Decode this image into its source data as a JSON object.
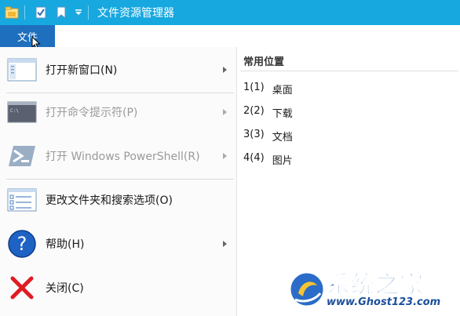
{
  "window": {
    "title": "文件资源管理器"
  },
  "ribbon": {
    "file_tab": "文件"
  },
  "menu": {
    "items": [
      {
        "label": "打开新窗口(N)",
        "enabled": true,
        "submenu": true,
        "icon": "new-window-icon"
      },
      {
        "label": "打开命令提示符(P)",
        "enabled": false,
        "submenu": true,
        "icon": "command-prompt-icon"
      },
      {
        "label": "打开 Windows PowerShell(R)",
        "enabled": false,
        "submenu": true,
        "icon": "powershell-icon"
      },
      {
        "label": "更改文件夹和搜索选项(O)",
        "enabled": true,
        "submenu": false,
        "icon": "folder-options-icon"
      },
      {
        "label": "帮助(H)",
        "enabled": true,
        "submenu": true,
        "icon": "help-icon"
      },
      {
        "label": "关闭(C)",
        "enabled": true,
        "submenu": false,
        "icon": "close-icon"
      }
    ]
  },
  "frequent_places": {
    "title": "常用位置",
    "items": [
      {
        "key": "1(1)",
        "label": "桌面"
      },
      {
        "key": "2(2)",
        "label": "下载"
      },
      {
        "key": "3(3)",
        "label": "文档"
      },
      {
        "key": "4(4)",
        "label": "图片"
      }
    ]
  },
  "watermark": {
    "title": "系统之家",
    "url": "www.Ghost123.com"
  },
  "colors": {
    "titlebar": "#17a8e0",
    "file_tab": "#1f6fbf"
  }
}
